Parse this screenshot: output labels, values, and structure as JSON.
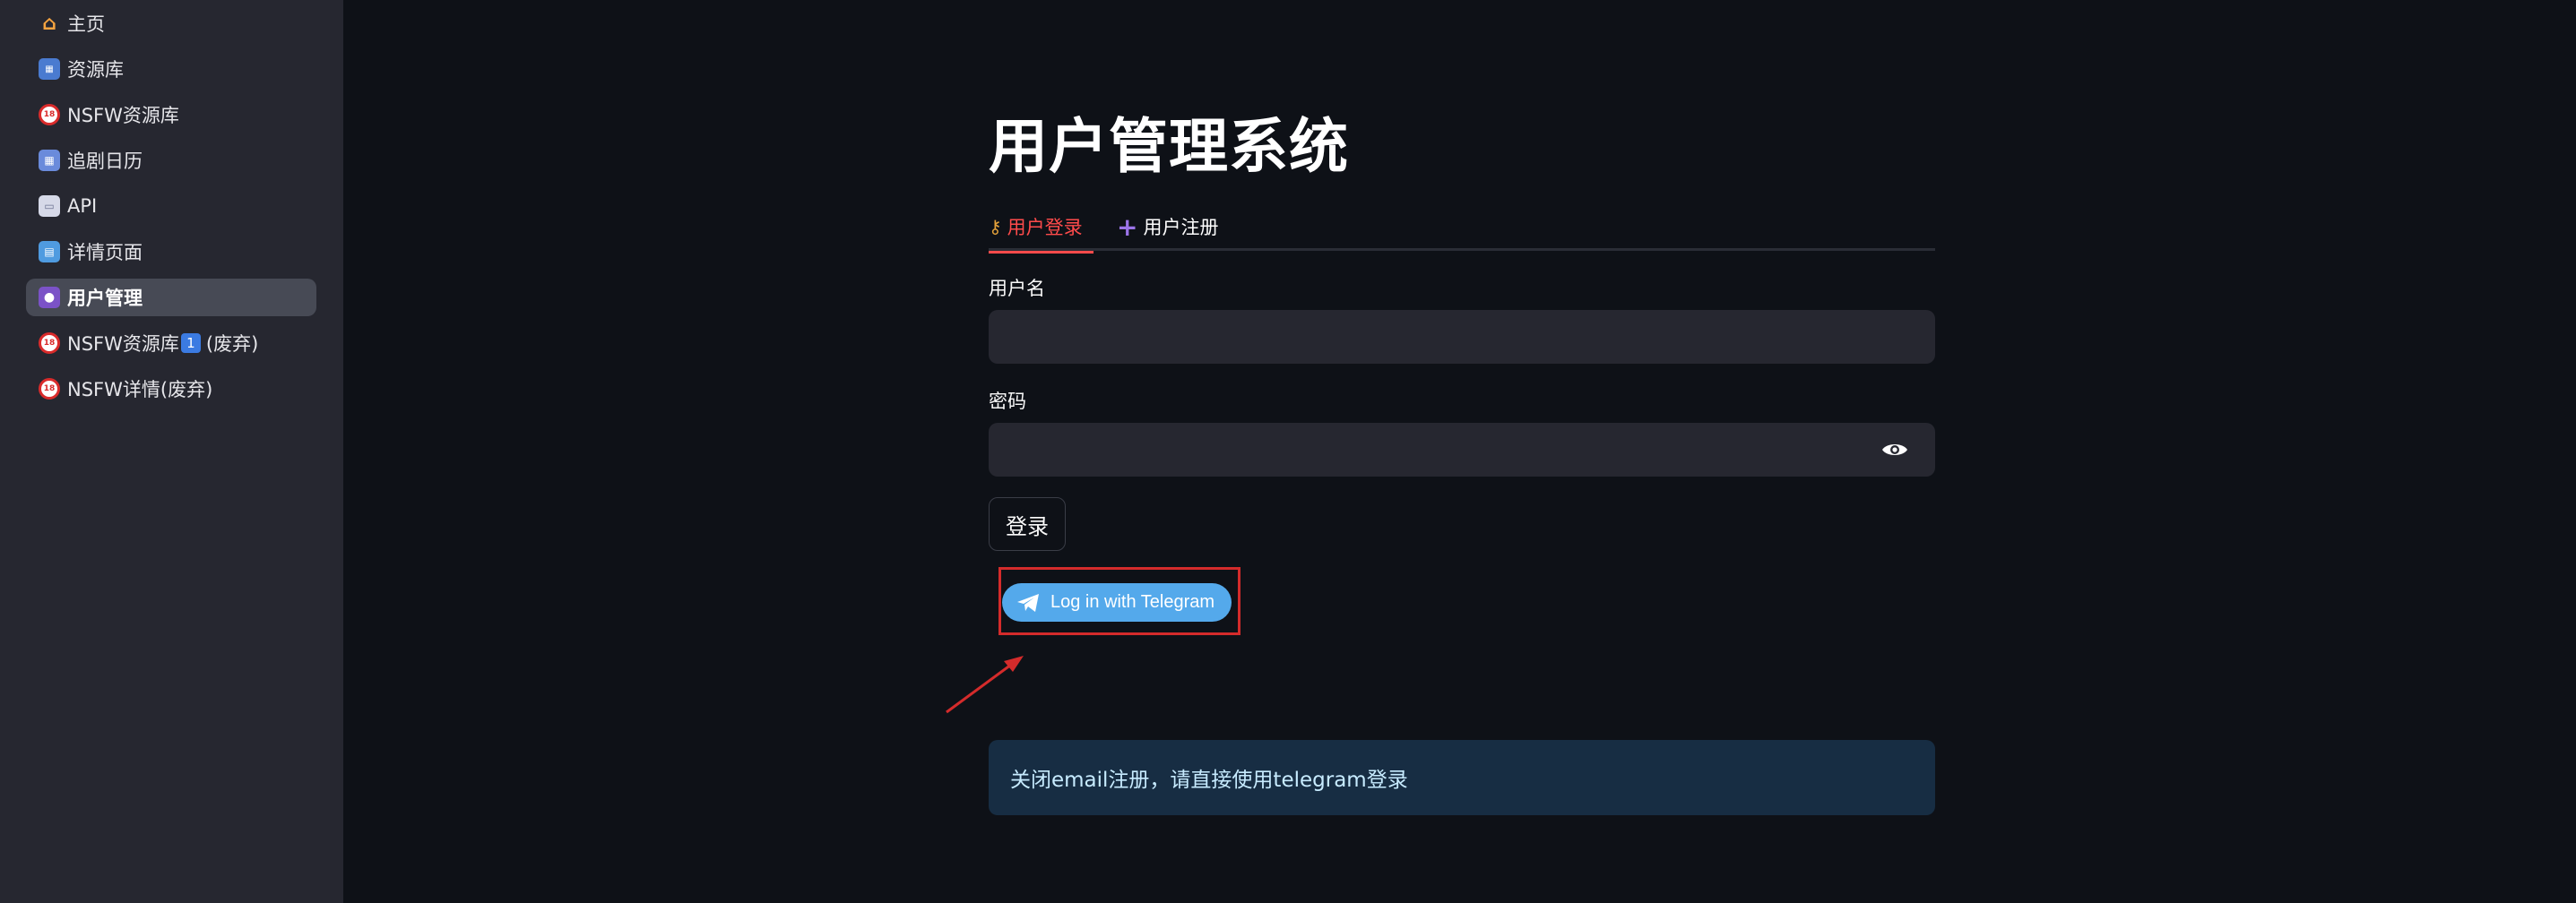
{
  "sidebar": {
    "items": [
      {
        "label": "主页",
        "icon": "house-icon",
        "glyph": "⌂"
      },
      {
        "label": "资源库",
        "icon": "film-library-icon",
        "glyph": "▦"
      },
      {
        "label": "NSFW资源库",
        "icon": "no-under-18-icon",
        "glyph": "18"
      },
      {
        "label": "追剧日历",
        "icon": "calendar-icon",
        "glyph": "▦"
      },
      {
        "label": "API",
        "icon": "book-icon",
        "glyph": "▭"
      },
      {
        "label": "详情页面",
        "icon": "detail-page-icon",
        "glyph": "▤"
      },
      {
        "label": "用户管理",
        "icon": "user-icon",
        "glyph": "●"
      },
      {
        "label": "NSFW资源库",
        "suffix": "(废弃)",
        "badge": "1",
        "icon": "no-under-18-icon",
        "glyph": "18"
      },
      {
        "label": "NSFW详情(废弃)",
        "icon": "no-under-18-icon",
        "glyph": "18"
      }
    ],
    "active_index": 6
  },
  "main": {
    "title": "用户管理系统",
    "tabs": [
      {
        "label": "用户登录",
        "icon": "key-icon",
        "glyph": "⚷"
      },
      {
        "label": "用户注册",
        "icon": "plus-icon",
        "glyph": "+"
      }
    ],
    "active_tab": 0,
    "username": {
      "label": "用户名",
      "value": "",
      "placeholder": ""
    },
    "password": {
      "label": "密码",
      "value": "",
      "placeholder": ""
    },
    "login_button": "登录",
    "telegram_button": "Log in with Telegram",
    "info_message": "关闭email注册，请直接使用telegram登录"
  },
  "colors": {
    "background": "#0e1117",
    "sidebar": "#262730",
    "accent": "#ff4b4b",
    "telegram": "#54a9eb",
    "info_bg": "#172d43",
    "annotation": "#d42b2b"
  }
}
